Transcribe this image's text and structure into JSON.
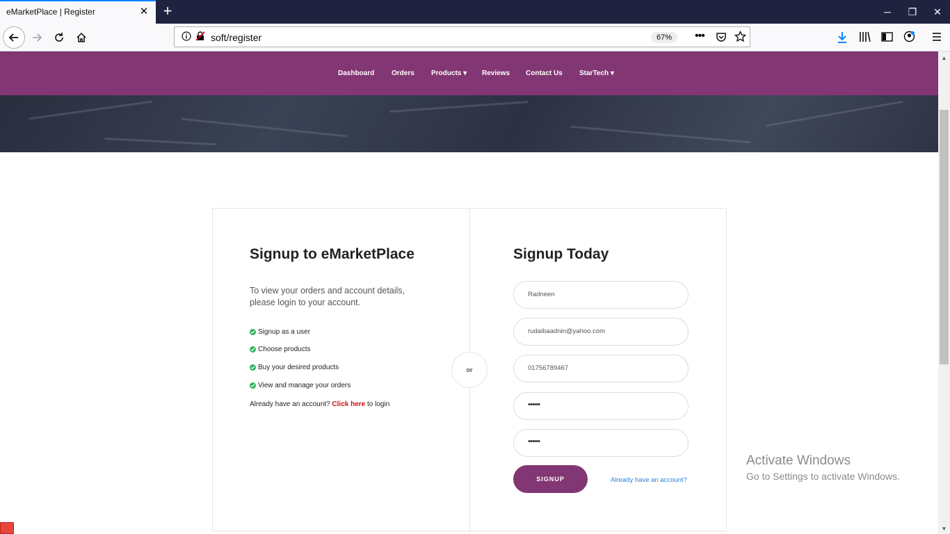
{
  "browser": {
    "tab_title": "eMarketPlace | Register",
    "url": "soft/register",
    "zoom": "67%",
    "icons": [
      "close-icon",
      "plus-icon",
      "back-arrow-icon",
      "forward-arrow-icon",
      "reload-icon",
      "home-icon",
      "info-icon",
      "insecure-lock-icon",
      "more-icon",
      "pocket-icon",
      "star-icon",
      "download-icon",
      "library-icon",
      "sidebar-icon",
      "account-icon",
      "menu-icon"
    ]
  },
  "site_nav": {
    "items": [
      {
        "label": "Dashboard"
      },
      {
        "label": "Orders"
      },
      {
        "label": "Products ▾"
      },
      {
        "label": "Reviews"
      },
      {
        "label": "Contact Us"
      },
      {
        "label": "StarTech ▾"
      }
    ]
  },
  "left_panel": {
    "title": "Signup to eMarketPlace",
    "description": "To view your orders and account details, please login to your account.",
    "features": [
      "Signup as a user",
      "Choose products",
      "Buy your desired products",
      "View and manage your orders"
    ],
    "login_prefix": "Already have an account? ",
    "login_link": "Click here",
    "login_suffix": " to login"
  },
  "divider": {
    "label": "or"
  },
  "right_panel": {
    "title": "Signup Today",
    "fields": {
      "name": "Radneen",
      "email": "rudaibaadnin@yahoo.com",
      "phone": "01756789467",
      "password": "••••••",
      "confirm_password": "••••••"
    },
    "signup_button": "SIGNUP",
    "already_link": "Already have an account?"
  },
  "watermark": {
    "title": "Activate Windows",
    "subtitle": "Go to Settings to activate Windows."
  },
  "colors": {
    "brand": "#823673",
    "titlebar": "#202340",
    "success": "#2fb35a",
    "link_red": "#cc1111",
    "link_blue": "#2b7fd6"
  }
}
